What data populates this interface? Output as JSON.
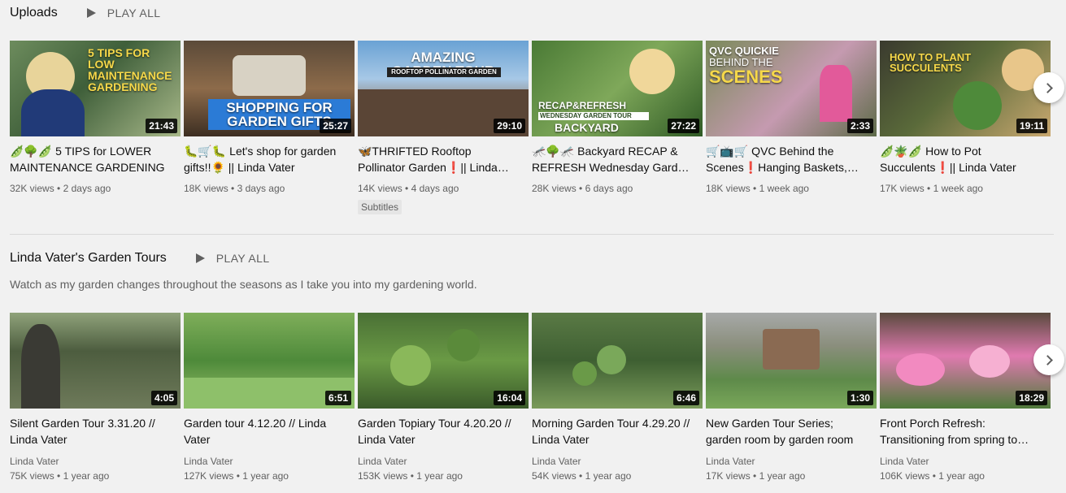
{
  "uploads": {
    "title": "Uploads",
    "play_all": "PLAY ALL",
    "videos": [
      {
        "title": "🫛🌳🫛 5 TIPS for LOWER MAINTENANCE GARDENING",
        "duration": "21:43",
        "views": "32K views",
        "age": "2 days ago",
        "thumb_text": "5 TIPS FOR LOW MAINTENANCE GARDENING",
        "badge": ""
      },
      {
        "title": "🐛🛒🐛 Let's shop for garden gifts!!🌻 || Linda Vater",
        "duration": "25:27",
        "views": "18K views",
        "age": "3 days ago",
        "thumb_text": "SHOPPING FOR GARDEN GIFTS",
        "badge": ""
      },
      {
        "title": "🦋THRIFTED Rooftop Pollinator Garden❗|| Linda Vater",
        "duration": "29:10",
        "views": "14K views",
        "age": "4 days ago",
        "thumb_text": "AMAZING GARDEN TOUR",
        "thumb_sub": "ROOFTOP POLLINATOR GARDEN",
        "badge": "Subtitles"
      },
      {
        "title": "🦟🌳🦟 Backyard RECAP & REFRESH Wednesday Garden Tour",
        "duration": "27:22",
        "views": "28K views",
        "age": "6 days ago",
        "thumb_text": "RECAP&REFRESH",
        "thumb_sub": "WEDNESDAY GARDEN TOUR",
        "thumb_text2": "BACKYARD",
        "badge": ""
      },
      {
        "title": "🛒📺🛒 QVC Behind the Scenes❗Hanging Baskets, Planters",
        "duration": "2:33",
        "views": "18K views",
        "age": "1 week ago",
        "thumb_text": "QVC QUICKIE",
        "thumb_sub": "BEHIND THE",
        "thumb_text2": "SCENES",
        "badge": ""
      },
      {
        "title": "🫛🪴🫛 How to Pot Succulents❗|| Linda Vater",
        "duration": "19:11",
        "views": "17K views",
        "age": "1 week ago",
        "thumb_text": "HOW TO PLANT SUCCULENTS",
        "badge": ""
      }
    ]
  },
  "tours": {
    "title": "Linda Vater's Garden Tours",
    "play_all": "PLAY ALL",
    "description": "Watch as my garden changes throughout the seasons as I take you into my gardening world.",
    "videos": [
      {
        "title": "Silent Garden Tour 3.31.20 // Linda Vater",
        "duration": "4:05",
        "channel": "Linda Vater",
        "views": "75K views",
        "age": "1 year ago"
      },
      {
        "title": "Garden tour 4.12.20 // Linda Vater",
        "duration": "6:51",
        "channel": "Linda Vater",
        "views": "127K views",
        "age": "1 year ago"
      },
      {
        "title": "Garden Topiary Tour 4.20.20 // Linda Vater",
        "duration": "16:04",
        "channel": "Linda Vater",
        "views": "153K views",
        "age": "1 year ago"
      },
      {
        "title": "Morning Garden Tour 4.29.20 // Linda Vater",
        "duration": "6:46",
        "channel": "Linda Vater",
        "views": "54K views",
        "age": "1 year ago"
      },
      {
        "title": "New Garden Tour Series; garden room by garden room",
        "duration": "1:30",
        "channel": "Linda Vater",
        "views": "17K views",
        "age": "1 year ago"
      },
      {
        "title": "Front Porch Refresh: Transitioning from spring to summer",
        "duration": "18:29",
        "channel": "Linda Vater",
        "views": "106K views",
        "age": "1 year ago"
      }
    ]
  },
  "separator": "•",
  "icons": {
    "play": "play-icon",
    "next": "chevron-right-icon"
  }
}
